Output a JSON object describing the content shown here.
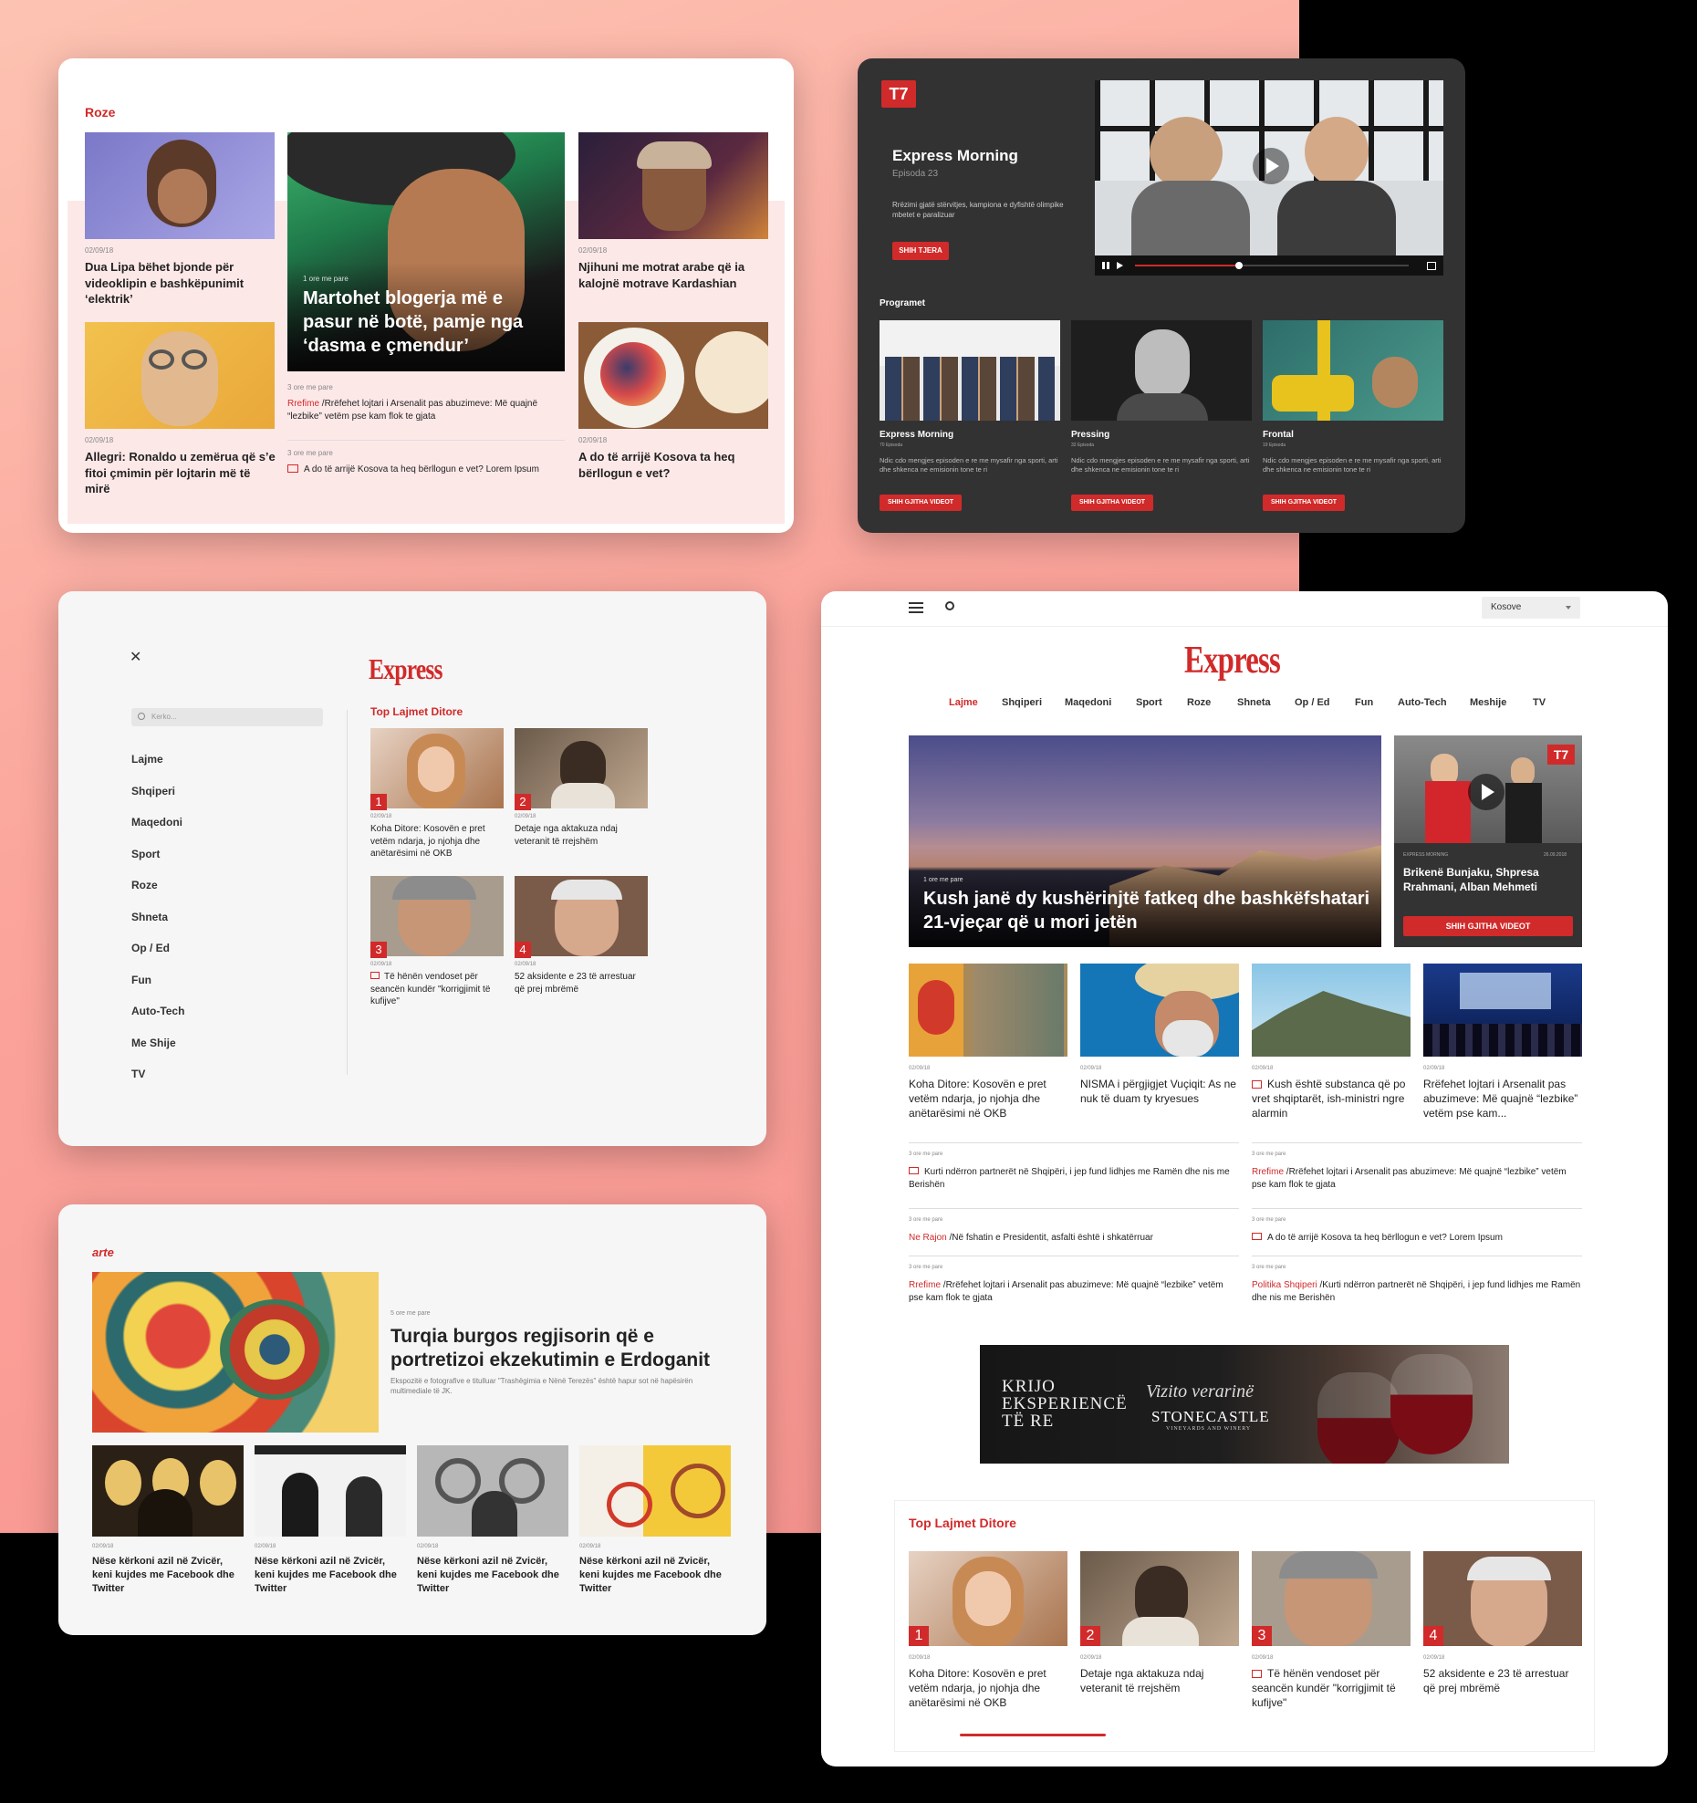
{
  "roze": {
    "section_title": "Roze",
    "colors": {
      "accent": "#d12a2a",
      "band": "#fde8e8"
    },
    "article1": {
      "date": "02/09/18",
      "title": "Dua Lipa bëhet bjonde për videoklipin e bashkëpunimit ‘elektrik’"
    },
    "article2": {
      "date": "02/09/18",
      "title": "Allegri: Ronaldo u zemërua që s’e fitoi çmimin për lojtarin më të mirë"
    },
    "featured": {
      "time": "1 ore me pare",
      "title": "Martohet blogerja më e pasur në botë, pamje nga ‘dasma e çmendur’"
    },
    "list": [
      {
        "time": "3 ore me pare",
        "category": "Rrefime",
        "text": "/Rrëfehet lojtari i Arsenalit pas abuzimeve: Më quajnë “lezbike” vetëm pse kam flok te gjata"
      },
      {
        "time": "3 ore me pare",
        "icon": "video-icon",
        "text": "A do të arrijë Kosova ta heq bërllogun e vet? Lorem Ipsum"
      }
    ],
    "article3": {
      "date": "02/09/18",
      "title": "Njihuni me motrat arabe që ia kalojnë motrave Kardashian"
    },
    "article4": {
      "date": "02/09/18",
      "title": "A do të arrijë Kosova ta heq bërllogun e vet?"
    }
  },
  "t7": {
    "logo": "T7",
    "show_title": "Express Morning",
    "episode": "Episoda 23",
    "description": "Rrëzimi gjatë stërvitjes, kampiona e dyfishtë olimpike mbetet e paralizuar",
    "more_button": "SHIH TJERA",
    "progress": 0.38,
    "programs_heading": "Programet",
    "programs": [
      {
        "name": "Express Morning",
        "episodes": "70 Episoda",
        "desc": "Ndic cdo mengjes episoden e re me mysafir nga sporti, arti dhe shkenca ne emisionin tone te ri",
        "button": "SHIH GJITHA VIDEOT"
      },
      {
        "name": "Pressing",
        "episodes": "32 Episoda",
        "desc": "Ndic cdo mengjes episoden e re me mysafir nga sporti, arti dhe shkenca ne emisionin tone te ri",
        "button": "SHIH GJITHA VIDEOT"
      },
      {
        "name": "Frontal",
        "episodes": "19 Episoda",
        "desc": "Ndic cdo mengjes episoden e re me mysafir nga sporti, arti dhe shkenca ne emisionin tone te ri",
        "button": "SHIH GJITHA VIDEOT"
      }
    ]
  },
  "menu": {
    "logo": "Express",
    "search_placeholder": "Kerko...",
    "items": [
      "Lajme",
      "Shqiperi",
      "Maqedoni",
      "Sport",
      "Roze",
      "Shneta",
      "Op / Ed",
      "Fun",
      "Auto-Tech",
      "Me Shije",
      "TV"
    ],
    "top_heading": "Top Lajmet Ditore",
    "top": [
      {
        "rank": "1",
        "date": "02/09/18",
        "title": "Koha Ditore: Kosovën e pret vetëm ndarja, jo njohja dhe anëtarësimi në OKB"
      },
      {
        "rank": "2",
        "date": "02/09/18",
        "title": "Detaje nga aktakuza ndaj veteranit të rrejshëm"
      },
      {
        "rank": "3",
        "date": "02/09/18",
        "title": "Të hënën vendoset për seancën kundër \"korrigjimit të kufijve\""
      },
      {
        "rank": "4",
        "date": "02/09/18",
        "title": "52 aksidente e 23 të arrestuar që prej mbrëmë"
      }
    ]
  },
  "arte": {
    "logo": "arte",
    "featured": {
      "time": "5 ore me pare",
      "title": "Turqia burgos regjisorin që e portretizoi ekzekutimin e Erdoganit",
      "summary": "Ekspozitë e fotografive e titulluar \"Trashëgimia e Nënë Terezës\" është hapur sot në hapësirën multimediale të JK."
    },
    "items": [
      {
        "date": "02/09/18",
        "title": "Nëse kërkoni azil në Zvicër, keni kujdes me Facebook dhe Twitter"
      },
      {
        "date": "02/09/18",
        "title": "Nëse kërkoni azil në Zvicër, keni kujdes me Facebook dhe Twitter"
      },
      {
        "date": "02/09/18",
        "title": "Nëse kërkoni azil në Zvicër, keni kujdes me Facebook dhe Twitter"
      },
      {
        "date": "02/09/18",
        "title": "Nëse kërkoni azil në Zvicër, keni kujdes me Facebook dhe Twitter"
      }
    ]
  },
  "express": {
    "region": "Kosove",
    "logo": "Express",
    "nav": [
      "Lajme",
      "Shqiperi",
      "Maqedoni",
      "Sport",
      "Roze",
      "Shneta",
      "Op / Ed",
      "Fun",
      "Auto-Tech",
      "Meshije",
      "TV"
    ],
    "hero": {
      "time": "1 ore me pare",
      "title": "Kush janë dy kushërinjtë fatkeq dhe bashkëfshatari 21-vjeçar që u mori jetën"
    },
    "video": {
      "logo": "T7",
      "show": "EXPRESS MORNING",
      "date": "26.09.2018",
      "title": "Brikenë Bunjaku, Shpresa Rrahmani, Alban Mehmeti",
      "button": "SHIH GJITHA VIDEOT"
    },
    "grid": [
      {
        "date": "02/09/18",
        "title": "Koha Ditore: Kosovën e pret vetëm ndarja, jo njohja dhe anëtarësimi në OKB"
      },
      {
        "date": "02/09/18",
        "title": "NISMA i përgjigjet Vuçiqit: As ne nuk të duam ty kryesues"
      },
      {
        "date": "02/09/18",
        "title": "Kush është substanca që po vret shqiptarët, ish-ministri ngre alarmin",
        "icon": "video-icon"
      },
      {
        "date": "02/09/18",
        "title": "Rrëfehet lojtari i Arsenalit pas abuzimeve: Më quajnë “lezbike” vetëm pse kam..."
      }
    ],
    "list_left": [
      {
        "time": "3 ore me pare",
        "icon": "video-icon",
        "text": "Kurti ndërron partnerët në Shqipëri, i jep fund lidhjes me Ramën dhe nis me Berishën"
      },
      {
        "time": "3 ore me pare",
        "category": "Ne Rajon",
        "text": "/Në fshatin e Presidentit, asfalti është i shkatërruar"
      },
      {
        "time": "3 ore me pare",
        "category": "Rrefime",
        "text": "/Rrëfehet lojtari i Arsenalit pas abuzimeve: Më quajnë “lezbike” vetëm pse kam flok te gjata"
      }
    ],
    "list_right": [
      {
        "time": "3 ore me pare",
        "category": "Rrefime",
        "text": "/Rrëfehet lojtari i Arsenalit pas abuzimeve: Më quajnë “lezbike” vetëm pse kam flok te gjata"
      },
      {
        "time": "3 ore me pare",
        "icon": "video-icon",
        "text": "A do të arrijë Kosova ta heq bërllogun e vet? Lorem Ipsum"
      },
      {
        "time": "3 ore me pare",
        "category": "Politika Shqiperi",
        "text": "/Kurti ndërron partnerët në Shqipëri, i jep fund lidhjes me Ramën dhe nis me Berishën"
      }
    ],
    "ad": {
      "line1": "KRIJO",
      "line2": "EKSPERIENCË",
      "line3": "TË RE",
      "script": "Vizito verarinë",
      "brand": "STONECASTLE",
      "sub": "VINEYARDS AND WINERY"
    },
    "top_heading": "Top Lajmet Ditore",
    "top": [
      {
        "rank": "1",
        "date": "02/09/18",
        "title": "Koha Ditore: Kosovën e pret vetëm ndarja, jo njohja dhe anëtarësimi në OKB"
      },
      {
        "rank": "2",
        "date": "02/09/18",
        "title": "Detaje nga aktakuza ndaj veteranit të rrejshëm"
      },
      {
        "rank": "3",
        "date": "02/09/18",
        "title": "Të hënën vendoset për seancën kundër \"korrigjimit të kufijve\"",
        "icon": "video-icon"
      },
      {
        "rank": "4",
        "date": "02/09/18",
        "title": "52 aksidente e 23 të arrestuar që prej mbrëmë"
      }
    ]
  }
}
